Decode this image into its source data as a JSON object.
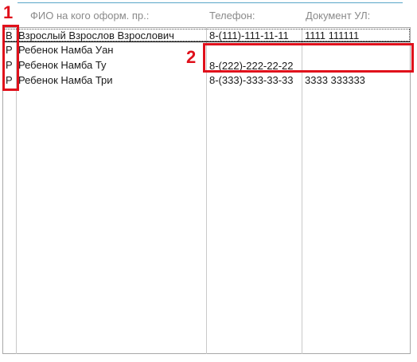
{
  "headers": {
    "fio": "ФИО на кого оформ. пр.:",
    "phone": "Телефон:",
    "document": "Документ УЛ:"
  },
  "rows": [
    {
      "type": "В",
      "fio": "Взрослый Взрослов Взрослович",
      "phone": "8-(111)-111-11-11",
      "document": "1111 111111"
    },
    {
      "type": "Р",
      "fio": "Ребенок Намба Уан",
      "phone": "",
      "document": ""
    },
    {
      "type": "Р",
      "fio": "Ребенок Намба Ту",
      "phone": "8-(222)-222-22-22",
      "document": ""
    },
    {
      "type": "Р",
      "fio": "Ребенок Намба Три",
      "phone": "8-(333)-333-33-33",
      "document": "3333 333333"
    }
  ],
  "annotations": {
    "marker1": "1",
    "marker2": "2",
    "color": "#e0101b"
  }
}
